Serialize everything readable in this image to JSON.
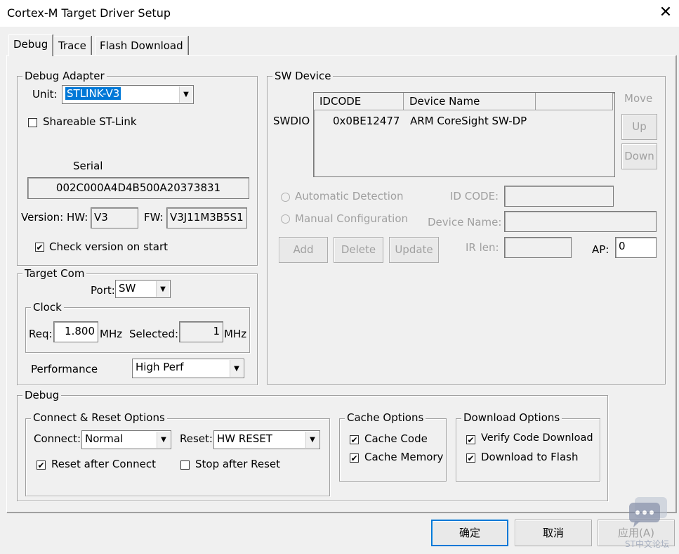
{
  "window": {
    "title": "Cortex-M Target Driver Setup"
  },
  "tabs": [
    "Debug",
    "Trace",
    "Flash Download"
  ],
  "debug_adapter": {
    "group_label": "Debug Adapter",
    "unit_label": "Unit:",
    "unit_value": "STLINK-V3",
    "shareable_label": "Shareable ST-Link",
    "shareable_checked": false,
    "serial_label": "Serial",
    "serial_value": "002C000A4D4B500A20373831",
    "version_label": "Version: HW:",
    "hw_value": "V3",
    "fw_label": "FW:",
    "fw_value": "V3J11M3B5S1",
    "check_version_label": "Check version on start",
    "check_version_checked": true
  },
  "target_com": {
    "group_label": "Target Com",
    "port_label": "Port:",
    "port_value": "SW",
    "clock_label": "Clock",
    "req_label": "Req:",
    "req_value": "1.800",
    "req_unit": "MHz",
    "selected_label": "Selected:",
    "selected_value": "1",
    "selected_unit": "MHz",
    "performance_label": "Performance",
    "performance_value": "High Perf"
  },
  "sw_device": {
    "group_label": "SW Device",
    "row_label": "SWDIO",
    "columns": [
      "IDCODE",
      "Device Name"
    ],
    "rows": [
      {
        "idcode": "0x0BE12477",
        "name": "ARM CoreSight SW-DP"
      }
    ],
    "move_label": "Move",
    "up_label": "Up",
    "down_label": "Down",
    "auto_detect_label": "Automatic Detection",
    "manual_config_label": "Manual Configuration",
    "id_code_label": "ID CODE:",
    "device_name_label": "Device Name:",
    "add_label": "Add",
    "delete_label": "Delete",
    "update_label": "Update",
    "ir_len_label": "IR len:",
    "ap_label": "AP:",
    "ap_value": "0"
  },
  "debug_section": {
    "group_label": "Debug",
    "connect_reset": {
      "group_label": "Connect & Reset Options",
      "connect_label": "Connect:",
      "connect_value": "Normal",
      "reset_label": "Reset:",
      "reset_value": "HW RESET",
      "reset_after_connect_label": "Reset after Connect",
      "reset_after_connect_checked": true,
      "stop_after_reset_label": "Stop after Reset",
      "stop_after_reset_checked": false
    },
    "cache": {
      "group_label": "Cache Options",
      "cache_code_label": "Cache Code",
      "cache_memory_label": "Cache Memory"
    },
    "download": {
      "group_label": "Download Options",
      "verify_label": "Verify Code Download",
      "download_flash_label": "Download to Flash"
    }
  },
  "footer": {
    "ok_label": "确定",
    "cancel_label": "取消",
    "apply_label": "应用(A)"
  },
  "watermark": {
    "text": "ST中文论坛"
  },
  "colors": {
    "accent": "#0078d7",
    "background": "#f0f0f0"
  }
}
